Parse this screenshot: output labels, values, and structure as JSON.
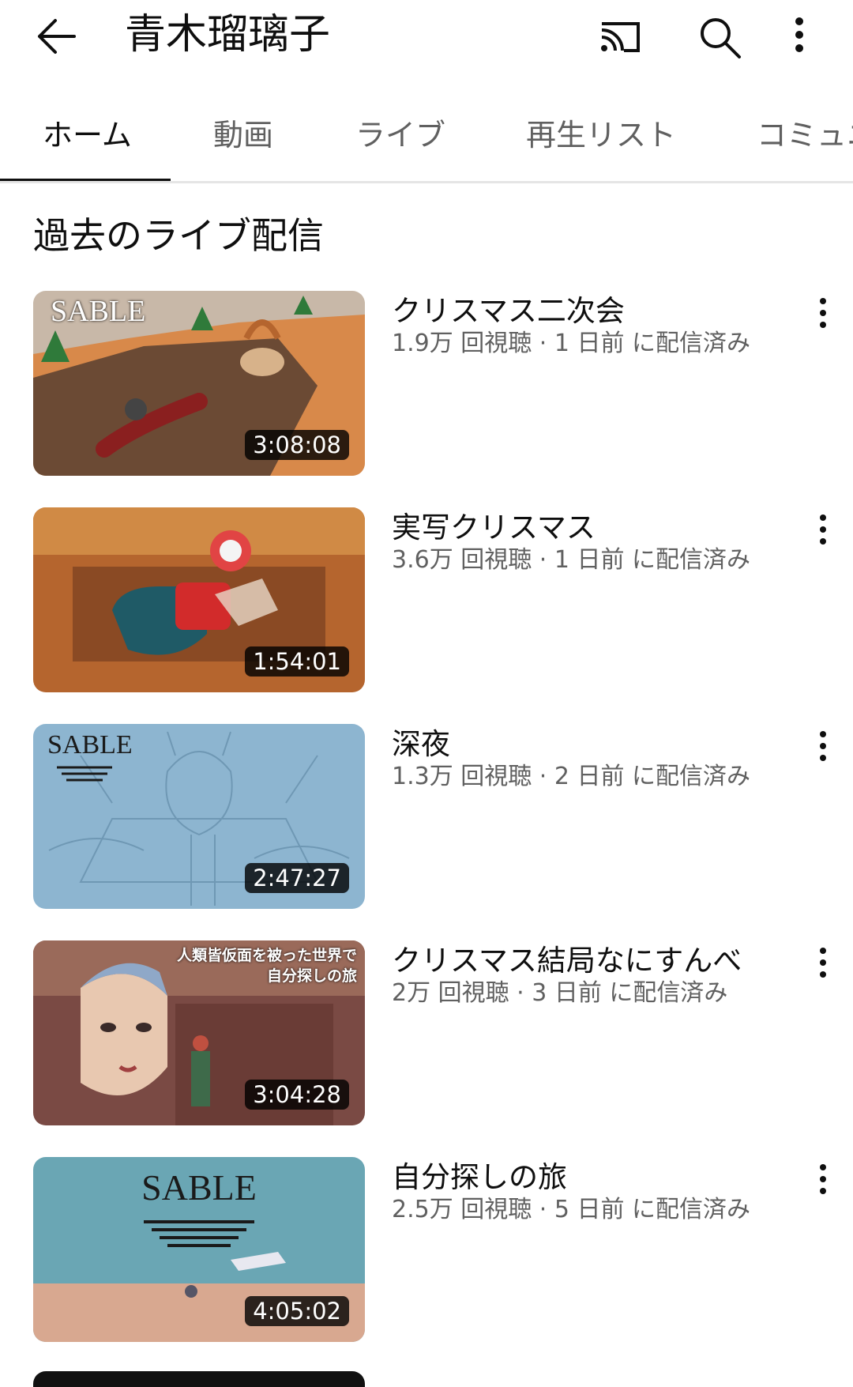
{
  "header": {
    "channel_title": "青木瑠璃子",
    "icons": [
      "back-arrow-icon",
      "cast-icon",
      "search-icon",
      "more-vert-icon"
    ]
  },
  "tabs": [
    {
      "label": "ホーム",
      "active": true
    },
    {
      "label": "動画",
      "active": false
    },
    {
      "label": "ライブ",
      "active": false
    },
    {
      "label": "再生リスト",
      "active": false
    },
    {
      "label": "コミュニ",
      "active": false
    }
  ],
  "section": {
    "title": "過去のライブ配信"
  },
  "videos": [
    {
      "title": "クリスマス二次会",
      "meta": "1.9万 回視聴 · 1 日前 に配信済み",
      "duration": "3:08:08",
      "thumb_text": "SABLE"
    },
    {
      "title": "実写クリスマス",
      "meta": "3.6万 回視聴 · 1 日前 に配信済み",
      "duration": "1:54:01"
    },
    {
      "title": "深夜",
      "meta": "1.3万 回視聴 · 2 日前 に配信済み",
      "duration": "2:47:27",
      "thumb_text": "SABLE"
    },
    {
      "title": "クリスマス結局なにすんべ",
      "meta": "2万 回視聴 · 3 日前 に配信済み",
      "duration": "3:04:28",
      "thumb_text_1": "人類皆仮面を被った世界で",
      "thumb_text_2": "自分探しの旅"
    },
    {
      "title": "自分探しの旅",
      "meta": "2.5万 回視聴 · 5 日前 に配信済み",
      "duration": "4:05:02",
      "thumb_text": "SABLE"
    }
  ],
  "colors": {
    "text_primary": "#0f0f0f",
    "text_secondary": "#606060",
    "divider": "#e5e5e5"
  }
}
